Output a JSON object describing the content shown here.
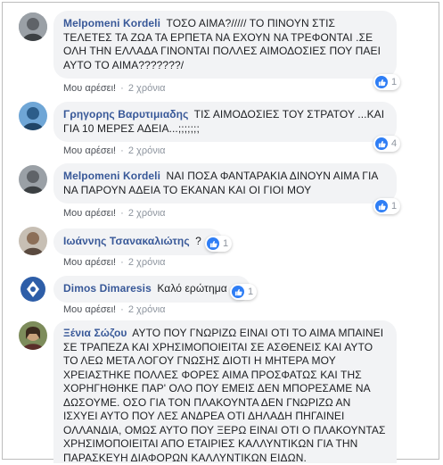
{
  "comments": [
    {
      "author": "Melpomeni Kordeli",
      "text": "ΤΟΣΟ ΑΙΜΑ?///// ΤΟ ΠΙΝΟΥΝ ΣΤΙΣ ΤΕΛΕΤΕΣ ΤΑ ΖΩΑ ΤΑ ΕΡΠΕΤΑ ΝΑ ΕΧΟΥΝ ΝΑ ΤΡΕΦΟΝΤΑΙ .ΣΕ ΟΛΗ ΤΗΝ ΕΛΛΑΔΑ ΓΙΝΟΝΤΑΙ ΠΟΛΛΕΣ ΑΙΜΟΔΟΣΙΕΣ ΠΟΥ ΠΑΕΙ ΑΥΤΟ ΤΟ ΑΙΜΑ???????/",
      "like_label": "Μου αρέσει!",
      "time": "2 χρόνια",
      "reactions": "1"
    },
    {
      "author": "Γρηγορης Βαρυτιμιαδης",
      "text": "ΤΙΣ ΑΙΜΟΔΟΣΙΕΣ ΤΟΥ ΣΤΡΑΤΟΥ ...ΚΑΙ ΓΙΑ 10 ΜΕΡΕΣ ΑΔΕΙΑ...;;;;;;;",
      "like_label": "Μου αρέσει!",
      "time": "2 χρόνια",
      "reactions": "4"
    },
    {
      "author": "Melpomeni Kordeli",
      "text": "ΝΑΙ ΠΟΣΑ ΦΑΝΤΑΡΑΚΙΑ ΔΙΝΟΥΝ ΑΙΜΑ ΓΙΑ ΝΑ ΠΑΡΟΥΝ ΑΔΕΙΑ ΤΟ ΕΚΑΝΑΝ ΚΑΙ ΟΙ ΓΙΟΙ ΜΟΥ",
      "like_label": "Μου αρέσει!",
      "time": "2 χρόνια",
      "reactions": "1"
    },
    {
      "author": "Ιωάννης Τσανακαλιώτης",
      "text": "?",
      "like_label": "Μου αρέσει!",
      "time": "2 χρόνια",
      "reactions": "1"
    },
    {
      "author": "Dimos Dimaresis",
      "text": "Καλό ερώτημα",
      "like_label": "Μου αρέσει!",
      "time": "2 χρόνια",
      "reactions": "1"
    },
    {
      "author": "Ξένια Σώζου",
      "text": "ΑΥΤΟ ΠΟΥ ΓΝΩΡΙΖΩ ΕΙΝΑΙ ΟΤΙ ΤΟ ΑΙΜΑ ΜΠΑΙΝΕΙ ΣΕ ΤΡΑΠΕΖΑ ΚΑΙ ΧΡΗΣΙΜΟΠΟΙΕΙΤΑΙ ΣΕ ΑΣΘΕΝΕΙΣ ΚΑΙ ΑΥΤΟ ΤΟ ΛΕΩ ΜΕΤΑ ΛΟΓΟΥ ΓΝΩΣΗΣ ΔΙΟΤΙ Η ΜΗΤΕΡΑ ΜΟΥ ΧΡΕΙΑΣΤΗΚΕ ΠΟΛΛΕΣ ΦΟΡΕΣ ΑΙΜΑ ΠΡΟΣΦΑΤΩΣ ΚΑΙ ΤΗΣ ΧΟΡΗΓΗΘΗΚΕ ΠΑΡ' ΟΛΟ ΠΟΥ ΕΜΕΙΣ ΔΕΝ ΜΠΟΡΕΣΑΜΕ ΝΑ ΔΩΣΟΥΜΕ. ΟΣΟ ΓΙΑ ΤΟΝ ΠΛΑΚΟΥΝΤΑ ΔΕΝ ΓΝΩΡΙΖΩ ΑΝ ΙΣΧΥΕΙ ΑΥΤΟ ΠΟΥ ΛΕΣ ΑΝΔΡΕΑ ΟΤΙ ΔΗΛΑΔΗ ΠΗΓΑΙΝΕΙ ΟΛΛΑΝΔΙΑ, ΟΜΩΣ ΑΥΤΟ ΠΟΥ ΞΕΡΩ ΕΙΝΑΙ ΟΤΙ Ο ΠΛΑΚΟΥΝΤΑΣ ΧΡΗΣΙΜΟΠΟΙΕΙΤΑΙ ΑΠΟ ΕΤΑΙΡΙΕΣ ΚΑΛΛΥΝΤΙΚΩΝ ΓΙΑ ΤΗΝ ΠΑΡΑΣΚΕΥΗ ΔΙΑΦΟΡΩΝ ΚΑΛΛΥΝΤΙΚΩΝ ΕΙΔΩΝ."
    }
  ],
  "colors": {
    "author": "#385898",
    "bubble": "#f2f3f5",
    "like_blue": "#2f7ef5",
    "meta": "#8d949e"
  },
  "icons": [
    "like-icon"
  ]
}
